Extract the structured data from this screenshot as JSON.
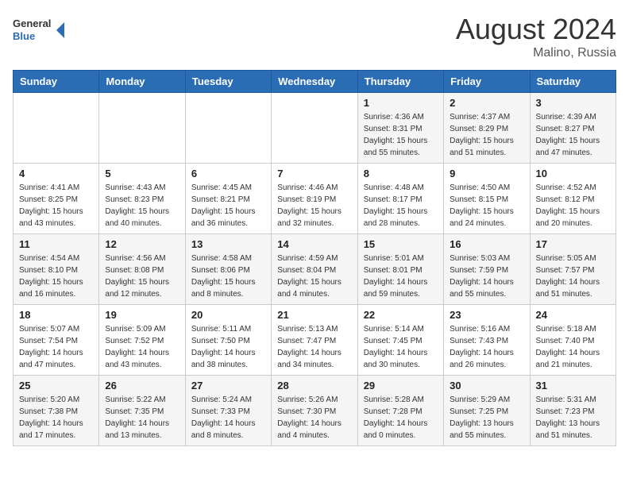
{
  "header": {
    "logo_line1": "General",
    "logo_line2": "Blue",
    "month_year": "August 2024",
    "location": "Malino, Russia"
  },
  "days_of_week": [
    "Sunday",
    "Monday",
    "Tuesday",
    "Wednesday",
    "Thursday",
    "Friday",
    "Saturday"
  ],
  "weeks": [
    [
      {
        "day": "",
        "info": ""
      },
      {
        "day": "",
        "info": ""
      },
      {
        "day": "",
        "info": ""
      },
      {
        "day": "",
        "info": ""
      },
      {
        "day": "1",
        "info": "Sunrise: 4:36 AM\nSunset: 8:31 PM\nDaylight: 15 hours\nand 55 minutes."
      },
      {
        "day": "2",
        "info": "Sunrise: 4:37 AM\nSunset: 8:29 PM\nDaylight: 15 hours\nand 51 minutes."
      },
      {
        "day": "3",
        "info": "Sunrise: 4:39 AM\nSunset: 8:27 PM\nDaylight: 15 hours\nand 47 minutes."
      }
    ],
    [
      {
        "day": "4",
        "info": "Sunrise: 4:41 AM\nSunset: 8:25 PM\nDaylight: 15 hours\nand 43 minutes."
      },
      {
        "day": "5",
        "info": "Sunrise: 4:43 AM\nSunset: 8:23 PM\nDaylight: 15 hours\nand 40 minutes."
      },
      {
        "day": "6",
        "info": "Sunrise: 4:45 AM\nSunset: 8:21 PM\nDaylight: 15 hours\nand 36 minutes."
      },
      {
        "day": "7",
        "info": "Sunrise: 4:46 AM\nSunset: 8:19 PM\nDaylight: 15 hours\nand 32 minutes."
      },
      {
        "day": "8",
        "info": "Sunrise: 4:48 AM\nSunset: 8:17 PM\nDaylight: 15 hours\nand 28 minutes."
      },
      {
        "day": "9",
        "info": "Sunrise: 4:50 AM\nSunset: 8:15 PM\nDaylight: 15 hours\nand 24 minutes."
      },
      {
        "day": "10",
        "info": "Sunrise: 4:52 AM\nSunset: 8:12 PM\nDaylight: 15 hours\nand 20 minutes."
      }
    ],
    [
      {
        "day": "11",
        "info": "Sunrise: 4:54 AM\nSunset: 8:10 PM\nDaylight: 15 hours\nand 16 minutes."
      },
      {
        "day": "12",
        "info": "Sunrise: 4:56 AM\nSunset: 8:08 PM\nDaylight: 15 hours\nand 12 minutes."
      },
      {
        "day": "13",
        "info": "Sunrise: 4:58 AM\nSunset: 8:06 PM\nDaylight: 15 hours\nand 8 minutes."
      },
      {
        "day": "14",
        "info": "Sunrise: 4:59 AM\nSunset: 8:04 PM\nDaylight: 15 hours\nand 4 minutes."
      },
      {
        "day": "15",
        "info": "Sunrise: 5:01 AM\nSunset: 8:01 PM\nDaylight: 14 hours\nand 59 minutes."
      },
      {
        "day": "16",
        "info": "Sunrise: 5:03 AM\nSunset: 7:59 PM\nDaylight: 14 hours\nand 55 minutes."
      },
      {
        "day": "17",
        "info": "Sunrise: 5:05 AM\nSunset: 7:57 PM\nDaylight: 14 hours\nand 51 minutes."
      }
    ],
    [
      {
        "day": "18",
        "info": "Sunrise: 5:07 AM\nSunset: 7:54 PM\nDaylight: 14 hours\nand 47 minutes."
      },
      {
        "day": "19",
        "info": "Sunrise: 5:09 AM\nSunset: 7:52 PM\nDaylight: 14 hours\nand 43 minutes."
      },
      {
        "day": "20",
        "info": "Sunrise: 5:11 AM\nSunset: 7:50 PM\nDaylight: 14 hours\nand 38 minutes."
      },
      {
        "day": "21",
        "info": "Sunrise: 5:13 AM\nSunset: 7:47 PM\nDaylight: 14 hours\nand 34 minutes."
      },
      {
        "day": "22",
        "info": "Sunrise: 5:14 AM\nSunset: 7:45 PM\nDaylight: 14 hours\nand 30 minutes."
      },
      {
        "day": "23",
        "info": "Sunrise: 5:16 AM\nSunset: 7:43 PM\nDaylight: 14 hours\nand 26 minutes."
      },
      {
        "day": "24",
        "info": "Sunrise: 5:18 AM\nSunset: 7:40 PM\nDaylight: 14 hours\nand 21 minutes."
      }
    ],
    [
      {
        "day": "25",
        "info": "Sunrise: 5:20 AM\nSunset: 7:38 PM\nDaylight: 14 hours\nand 17 minutes."
      },
      {
        "day": "26",
        "info": "Sunrise: 5:22 AM\nSunset: 7:35 PM\nDaylight: 14 hours\nand 13 minutes."
      },
      {
        "day": "27",
        "info": "Sunrise: 5:24 AM\nSunset: 7:33 PM\nDaylight: 14 hours\nand 8 minutes."
      },
      {
        "day": "28",
        "info": "Sunrise: 5:26 AM\nSunset: 7:30 PM\nDaylight: 14 hours\nand 4 minutes."
      },
      {
        "day": "29",
        "info": "Sunrise: 5:28 AM\nSunset: 7:28 PM\nDaylight: 14 hours\nand 0 minutes."
      },
      {
        "day": "30",
        "info": "Sunrise: 5:29 AM\nSunset: 7:25 PM\nDaylight: 13 hours\nand 55 minutes."
      },
      {
        "day": "31",
        "info": "Sunrise: 5:31 AM\nSunset: 7:23 PM\nDaylight: 13 hours\nand 51 minutes."
      }
    ]
  ]
}
